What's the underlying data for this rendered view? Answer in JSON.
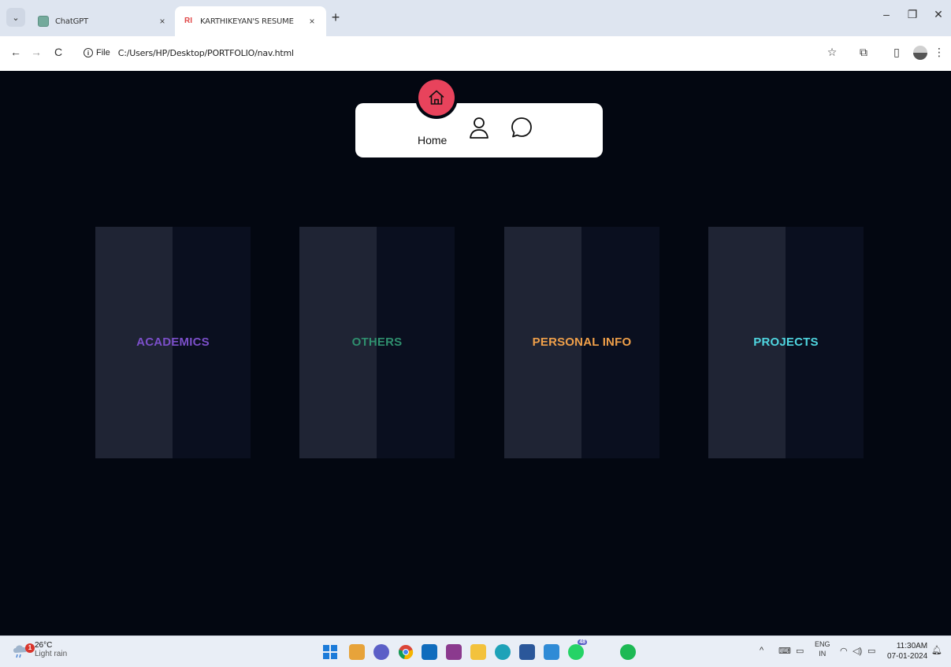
{
  "browser": {
    "tabs": [
      {
        "title": "ChatGPT",
        "active": false
      },
      {
        "title": "KARTHIKEYAN'S RESUME",
        "active": true
      }
    ],
    "resume_favicon": "RI",
    "close_glyph": "×",
    "new_tab_glyph": "+",
    "tab_search_glyph": "⌄",
    "window_controls": {
      "minimize": "–",
      "restore": "❐",
      "close": "✕"
    },
    "nav": {
      "back": "←",
      "forward": "→",
      "reload": "C"
    },
    "address": {
      "scheme_label": "File",
      "url": "C:/Users/HP/Desktop/PORTFOLIO/nav.html"
    },
    "toolbar_icons": {
      "bookmark": "☆",
      "extensions": "⧉",
      "sidepanel": "▯",
      "menu": "⋮"
    }
  },
  "page": {
    "nav": {
      "home_label": "Home",
      "icons": [
        "home-icon",
        "user-icon",
        "chat-bubble-icon"
      ],
      "active_color": "#e8435c"
    },
    "cards": [
      {
        "label": "ACADEMICS",
        "color": "#7b4fc9"
      },
      {
        "label": "OTHERS",
        "color": "#2f8f6e"
      },
      {
        "label": "PERSONAL INFO",
        "color": "#f0a04a"
      },
      {
        "label": "PROJECTS",
        "color": "#4fd6e0"
      }
    ]
  },
  "taskbar": {
    "weather": {
      "temp": "26°C",
      "condition": "Light rain",
      "badge": "1"
    },
    "apps": [
      "windows-start-icon",
      "phi-icon",
      "copilot-icon",
      "chrome-icon",
      "mail-icon",
      "winrar-icon",
      "file-explorer-icon",
      "edge-icon",
      "word-icon",
      "vscode-icon",
      "whatsapp-icon",
      "spotify-icon"
    ],
    "whatsapp_badge": "48",
    "tray": {
      "chevron": "^",
      "lang_top": "ENG",
      "lang_bottom": "IN"
    },
    "clock": {
      "time": "11:30AM",
      "date": "07-01-2024"
    }
  }
}
